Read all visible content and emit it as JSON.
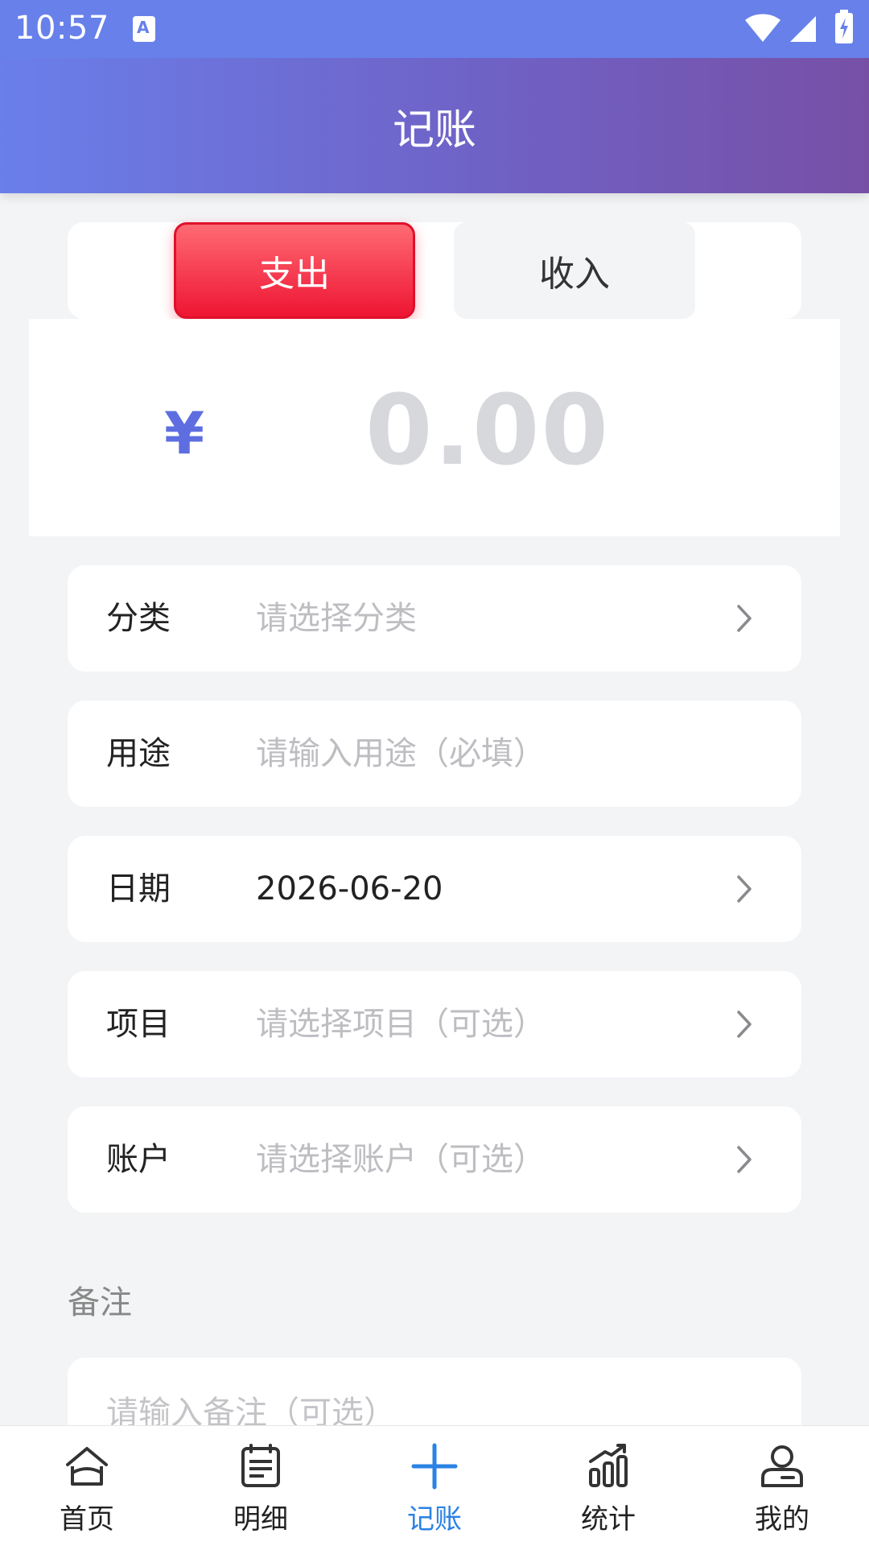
{
  "status_bar": {
    "time": "10:57",
    "notification_icon": "a-keyboard-icon",
    "icons": [
      "wifi-icon",
      "signal-icon",
      "battery-charging-icon"
    ]
  },
  "header": {
    "title": "记账"
  },
  "type_toggle": {
    "expense_label": "支出",
    "income_label": "收入",
    "selected": "expense"
  },
  "amount": {
    "currency_symbol": "¥",
    "value": "0.00"
  },
  "form": {
    "category": {
      "label": "分类",
      "placeholder": "请选择分类",
      "value": ""
    },
    "purpose": {
      "label": "用途",
      "placeholder": "请输入用途（必填）",
      "value": ""
    },
    "date": {
      "label": "日期",
      "value": "2026-06-20"
    },
    "project": {
      "label": "项目",
      "placeholder": "请选择项目（可选）",
      "value": ""
    },
    "account": {
      "label": "账户",
      "placeholder": "请选择账户（可选）",
      "value": ""
    }
  },
  "remark": {
    "label": "备注",
    "placeholder": "请输入备注（可选）"
  },
  "bottom_nav": {
    "items": [
      {
        "label": "首页",
        "icon": "home-icon"
      },
      {
        "label": "明细",
        "icon": "list-icon"
      },
      {
        "label": "记账",
        "icon": "plus-icon",
        "active": true
      },
      {
        "label": "统计",
        "icon": "chart-icon"
      },
      {
        "label": "我的",
        "icon": "user-icon"
      }
    ]
  },
  "colors": {
    "header_gradient_start": "#6a7fea",
    "header_gradient_end": "#7750a6",
    "expense_red": "#ee1533",
    "currency_blue": "#5e6ee0",
    "nav_active": "#2a82e4"
  }
}
